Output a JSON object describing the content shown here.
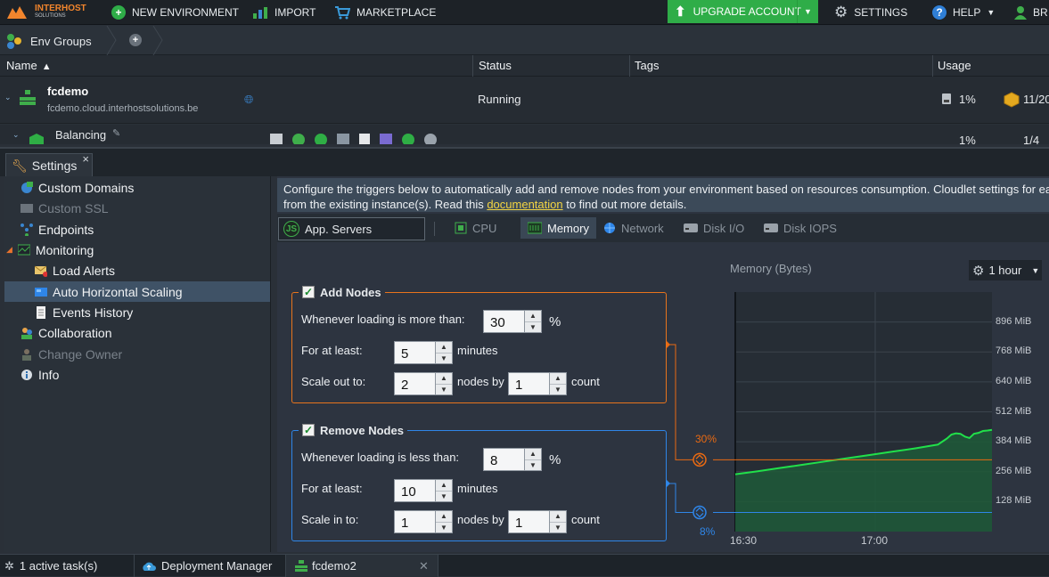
{
  "topbar": {
    "logo_top": "INTERHOST",
    "logo_bottom": "SOLUTIONS",
    "new_environment": "NEW ENVIRONMENT",
    "import": "IMPORT",
    "marketplace": "MARKETPLACE",
    "upgrade": "UPGRADE ACCOUNT",
    "settings": "SETTINGS",
    "help": "HELP",
    "user": "BR"
  },
  "envbar": {
    "groups_label": "Env Groups"
  },
  "columns": {
    "name": "Name",
    "status": "Status",
    "tags": "Tags",
    "usage": "Usage"
  },
  "environment": {
    "name": "fcdemo",
    "domain": "fcdemo.cloud.interhostsolutions.be",
    "status": "Running",
    "disk_usage": "1%",
    "cloudlets": "11/20",
    "node_name": "Balancing",
    "node_usage": "1%",
    "node_cloudlets": "1/4"
  },
  "settings_tab": {
    "label": "Settings",
    "close": "×"
  },
  "sidebar": {
    "custom_domains": "Custom Domains",
    "custom_ssl": "Custom SSL",
    "endpoints": "Endpoints",
    "monitoring": "Monitoring",
    "load_alerts": "Load Alerts",
    "auto_scaling": "Auto Horizontal Scaling",
    "events_history": "Events History",
    "collaboration": "Collaboration",
    "change_owner": "Change Owner",
    "info": "Info"
  },
  "description": {
    "line1": "Configure the triggers below to automatically add and remove nodes from your environment based on resources consumption. Cloudlet settings for each",
    "line2_pre": "from the existing instance(s). Read this ",
    "link": "documentation",
    "line2_post": " to find out more details."
  },
  "node_select": "App. Servers",
  "metric_tabs": {
    "cpu": "CPU",
    "memory": "Memory",
    "network": "Network",
    "disk_io": "Disk I/O",
    "disk_iops": "Disk IOPS"
  },
  "add_nodes": {
    "title": "Add Nodes",
    "loading_label": "Whenever loading is more than:",
    "loading_value": "30",
    "percent": "%",
    "period_label": "For at least:",
    "period_value": "5",
    "minutes": "minutes",
    "scale_label": "Scale out to:",
    "scale_value": "2",
    "nodes_by": "nodes by",
    "step_value": "1",
    "count": "count"
  },
  "remove_nodes": {
    "title": "Remove Nodes",
    "loading_label": "Whenever loading is less than:",
    "loading_value": "8",
    "percent": "%",
    "period_label": "For at least:",
    "period_value": "10",
    "minutes": "minutes",
    "scale_label": "Scale in to:",
    "scale_value": "1",
    "nodes_by": "nodes by",
    "step_value": "1",
    "count": "count"
  },
  "chart_data": {
    "type": "area",
    "title": "Memory (Bytes)",
    "period": "1 hour",
    "x_ticks": [
      "16:30",
      "17:00"
    ],
    "y_ticks": [
      "128 MiB",
      "256 MiB",
      "384 MiB",
      "512 MiB",
      "640 MiB",
      "768 MiB",
      "896 MiB"
    ],
    "ylim": [
      0,
      1024
    ],
    "add_threshold_label": "30%",
    "remove_threshold_label": "8%",
    "add_threshold_mib": 307,
    "remove_threshold_mib": 82,
    "series": [
      {
        "x": [
          0,
          5,
          10,
          15,
          20,
          25,
          30,
          35,
          40,
          45,
          46,
          47,
          48,
          49,
          50,
          51,
          52,
          53,
          54,
          55,
          56,
          57
        ],
        "y": [
          245,
          258,
          272,
          286,
          300,
          314,
          328,
          342,
          356,
          372,
          385,
          398,
          415,
          420,
          418,
          406,
          400,
          418,
          422,
          430,
          432,
          435
        ]
      }
    ],
    "x_range": [
      0,
      57
    ],
    "colors": {
      "line": "#21e04a",
      "fill": "#1f5a38",
      "add": "#ea6a12",
      "remove": "#2f86e8"
    }
  },
  "bottombar": {
    "tasks": "1 active task(s)",
    "deployment_manager": "Deployment Manager",
    "env_tab": "fcdemo2"
  }
}
